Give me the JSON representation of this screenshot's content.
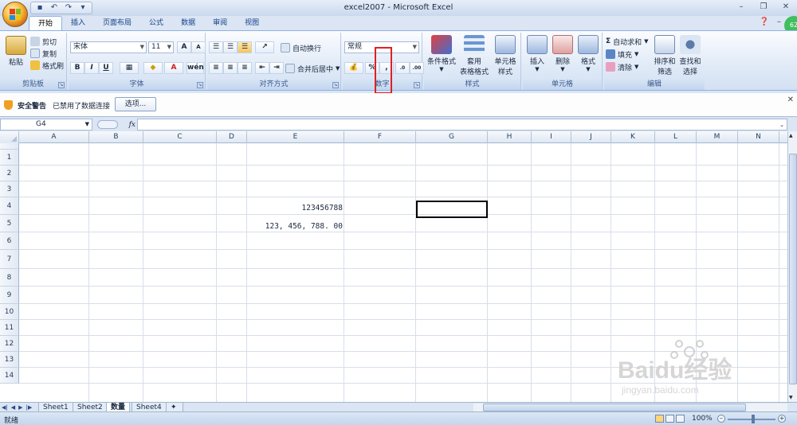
{
  "window": {
    "title": "excel2007 - Microsoft Excel"
  },
  "qat": {
    "save": "save-icon",
    "undo": "undo-icon",
    "redo": "redo-icon"
  },
  "tabs": [
    "开始",
    "插入",
    "页面布局",
    "公式",
    "数据",
    "审阅",
    "视图"
  ],
  "user_badge": "62",
  "ribbon": {
    "clipboard": {
      "label": "剪贴板",
      "paste": "粘贴",
      "cut": "剪切",
      "copy": "复制",
      "format_painter": "格式刷"
    },
    "font": {
      "label": "字体",
      "font_name": "宋体",
      "font_size": "11",
      "bold": "B",
      "italic": "I",
      "underline": "U",
      "grow": "A",
      "shrink": "A"
    },
    "alignment": {
      "label": "对齐方式",
      "wrap_text": "自动换行",
      "merge_center": "合并后居中"
    },
    "number": {
      "label": "数字",
      "format": "常规",
      "percent": "%"
    },
    "styles": {
      "label": "样式",
      "conditional": "条件格式",
      "table_format_1": "套用",
      "table_format_2": "表格格式",
      "cell_styles_1": "单元格",
      "cell_styles_2": "样式"
    },
    "cells": {
      "label": "单元格",
      "insert": "插入",
      "delete": "删除",
      "format": "格式"
    },
    "editing": {
      "label": "编辑",
      "autosum": "自动求和",
      "fill": "填充",
      "clear": "清除",
      "sort_1": "排序和",
      "sort_2": "筛选",
      "find_1": "查找和",
      "find_2": "选择"
    }
  },
  "security": {
    "title": "安全警告",
    "message": "已禁用了数据连接",
    "options": "选项..."
  },
  "formula_bar": {
    "name_box": "G4",
    "fx": "fx",
    "value": ""
  },
  "columns": [
    "A",
    "B",
    "C",
    "D",
    "E",
    "F",
    "G",
    "H",
    "I",
    "J",
    "K",
    "L",
    "M",
    "N"
  ],
  "rows": [
    "1",
    "2",
    "3",
    "4",
    "5",
    "6",
    "7",
    "8",
    "9",
    "10",
    "11",
    "12",
    "13",
    "14"
  ],
  "cells": {
    "E4": "123456788",
    "E5": "123, 456, 788. 00"
  },
  "sheets": [
    "Sheet1",
    "Sheet2",
    "数量",
    "Sheet4"
  ],
  "active_sheet": "数量",
  "status": {
    "text": "就绪",
    "zoom": "100%"
  },
  "watermark": {
    "text": "Baidu经验",
    "url": "jingyan.baidu.com"
  }
}
